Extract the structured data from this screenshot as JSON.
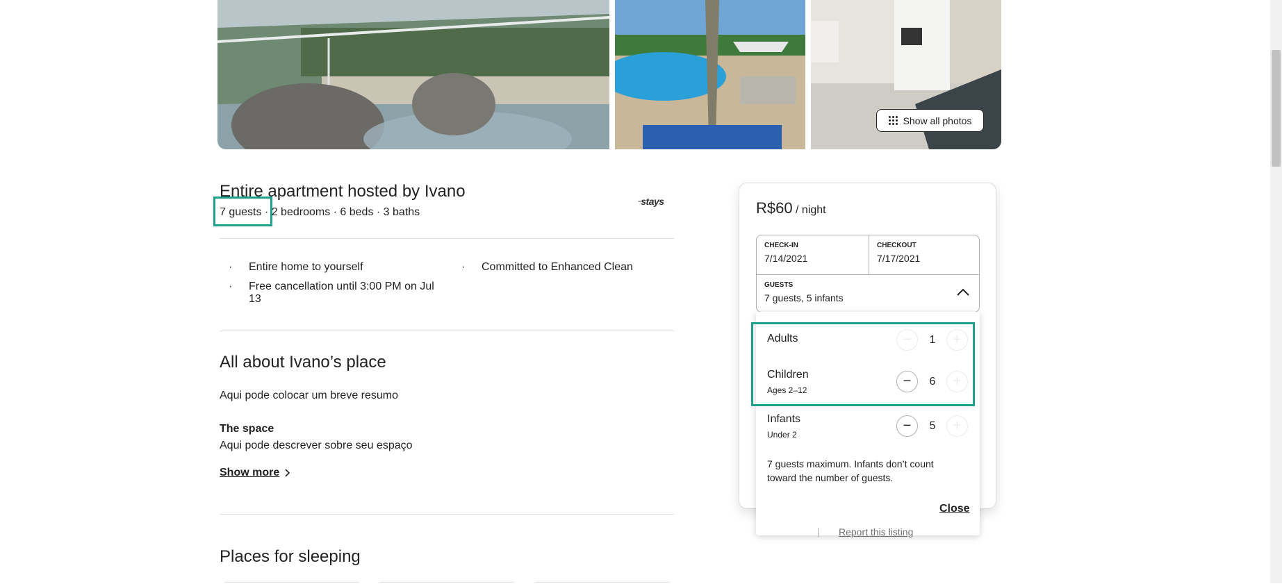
{
  "photos": {
    "show_all_label": "Show all photos"
  },
  "listing": {
    "title": "Entire apartment hosted by Ivano",
    "guests": "7 guests",
    "details": " · 2 bedrooms · 6 beds · 3 baths",
    "logo_text": "stays"
  },
  "highlights": [
    {
      "text": "Entire home to yourself"
    },
    {
      "text": "Committed to Enhanced Clean"
    },
    {
      "text_line1": "Free cancellation until 3:00 PM on Jul",
      "text_line2": "13"
    }
  ],
  "about": {
    "heading": "All about Ivano’s place",
    "summary": "Aqui pode colocar um breve resumo",
    "space_heading": "The space",
    "space_text": "Aqui pode descrever sobre seu espaço",
    "show_more": "Show more"
  },
  "sleeping": {
    "heading": "Places for sleeping"
  },
  "booking": {
    "price": "R$60",
    "per_night": " / night",
    "checkin_label": "CHECK-IN",
    "checkin_value": "7/14/2021",
    "checkout_label": "CHECKOUT",
    "checkout_value": "7/17/2021",
    "guests_label": "GUESTS",
    "guests_value": "7 guests, 5 infants",
    "report_link": "Report this listing"
  },
  "guest_picker": {
    "rows": [
      {
        "label": "Adults",
        "sub": "",
        "count": "1",
        "minus_enabled": false,
        "plus_enabled": false
      },
      {
        "label": "Children",
        "sub": "Ages 2–12",
        "count": "6",
        "minus_enabled": true,
        "plus_enabled": false
      },
      {
        "label": "Infants",
        "sub": "Under 2",
        "count": "5",
        "minus_enabled": true,
        "plus_enabled": false
      }
    ],
    "note_line1": "7 guests maximum. Infants don’t count",
    "note_line2": "toward the number of guests.",
    "close_label": "Close"
  },
  "colors": {
    "highlight_box": "#1fa08a",
    "text": "#222222",
    "divider": "#dddddd"
  }
}
